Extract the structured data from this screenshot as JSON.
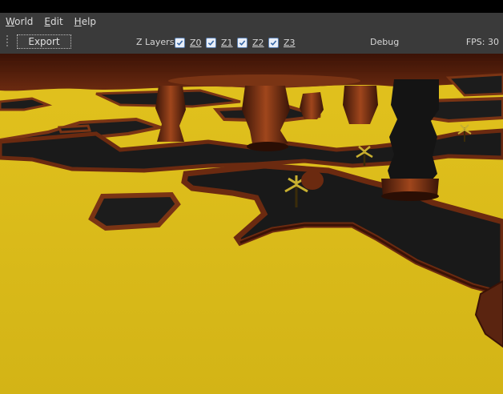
{
  "menu": {
    "items": [
      {
        "label": "World",
        "mnemonic": "W",
        "rest": "orld"
      },
      {
        "label": "Edit",
        "mnemonic": "E",
        "rest": "dit"
      },
      {
        "label": "Help",
        "mnemonic": "H",
        "rest": "elp"
      }
    ]
  },
  "toolbar": {
    "export_label": "Export",
    "zlayers_label": "Z Layers:",
    "layers": [
      {
        "label": "Z0",
        "checked": true
      },
      {
        "label": "Z1",
        "checked": true
      },
      {
        "label": "Z2",
        "checked": true
      },
      {
        "label": "Z3",
        "checked": true
      }
    ],
    "debug_label": "Debug",
    "fps_label": "FPS: 30"
  },
  "colors": {
    "background_bar": "#3a3a3a",
    "lava": "#d6b618",
    "rock_edge": "#6b2a10",
    "floor": "#1b1b1b",
    "checkbox_accent": "#3465a4"
  }
}
